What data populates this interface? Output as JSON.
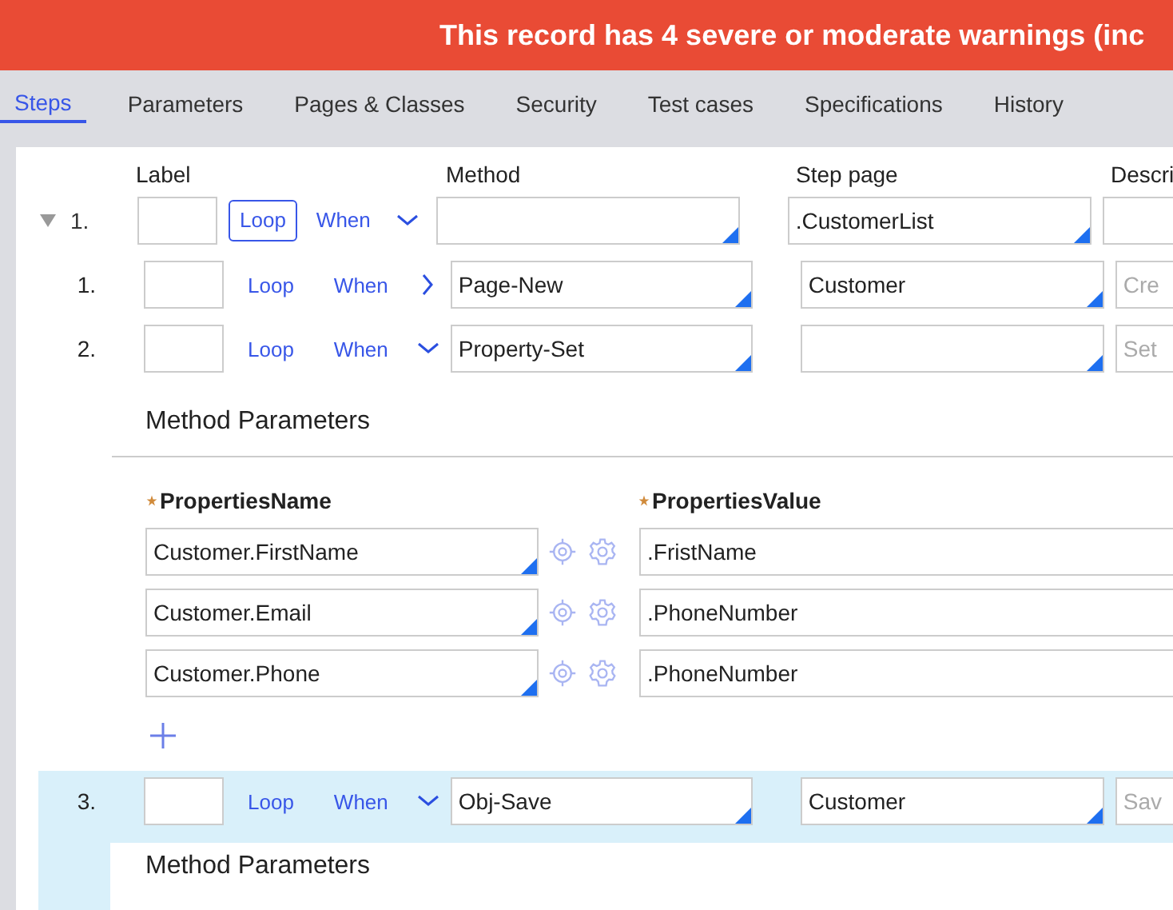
{
  "banner": {
    "text": "This record has 4 severe or moderate warnings (inc"
  },
  "tabs": [
    {
      "label": "Steps",
      "selected": true
    },
    {
      "label": "Parameters",
      "selected": false
    },
    {
      "label": "Pages & Classes",
      "selected": false
    },
    {
      "label": "Security",
      "selected": false
    },
    {
      "label": "Test cases",
      "selected": false
    },
    {
      "label": "Specifications",
      "selected": false
    },
    {
      "label": "History",
      "selected": false
    }
  ],
  "columns": {
    "label": "Label",
    "method": "Method",
    "step_page": "Step page",
    "description": "Descri"
  },
  "step": {
    "number": "1.",
    "expanded": true,
    "loop": "Loop",
    "loop_active": true,
    "when": "When",
    "when_expanded": true,
    "step_page": ".CustomerList",
    "children": [
      {
        "number": "1.",
        "selected": false,
        "loop": "Loop",
        "loop_active": false,
        "when": "When",
        "when_expanded": false,
        "method": "Page-New",
        "step_page": "Customer",
        "description_placeholder": "Cre"
      },
      {
        "number": "2.",
        "selected": false,
        "loop": "Loop",
        "loop_active": false,
        "when": "When",
        "when_expanded": true,
        "method": "Property-Set",
        "description_placeholder": "Set",
        "parameters": {
          "title": "Method Parameters",
          "name_header": "PropertiesName",
          "value_header": "PropertiesValue",
          "rows": [
            {
              "name": "Customer.FirstName",
              "value": ".FristName"
            },
            {
              "name": "Customer.Email",
              "value": ".PhoneNumber"
            },
            {
              "name": "Customer.Phone",
              "value": ".PhoneNumber"
            }
          ]
        }
      },
      {
        "number": "3.",
        "selected": true,
        "loop": "Loop",
        "loop_active": false,
        "when": "When",
        "when_expanded": true,
        "method": "Obj-Save",
        "step_page": "Customer",
        "description_placeholder": "Sav",
        "parameters_title": "Method Parameters"
      }
    ]
  }
}
